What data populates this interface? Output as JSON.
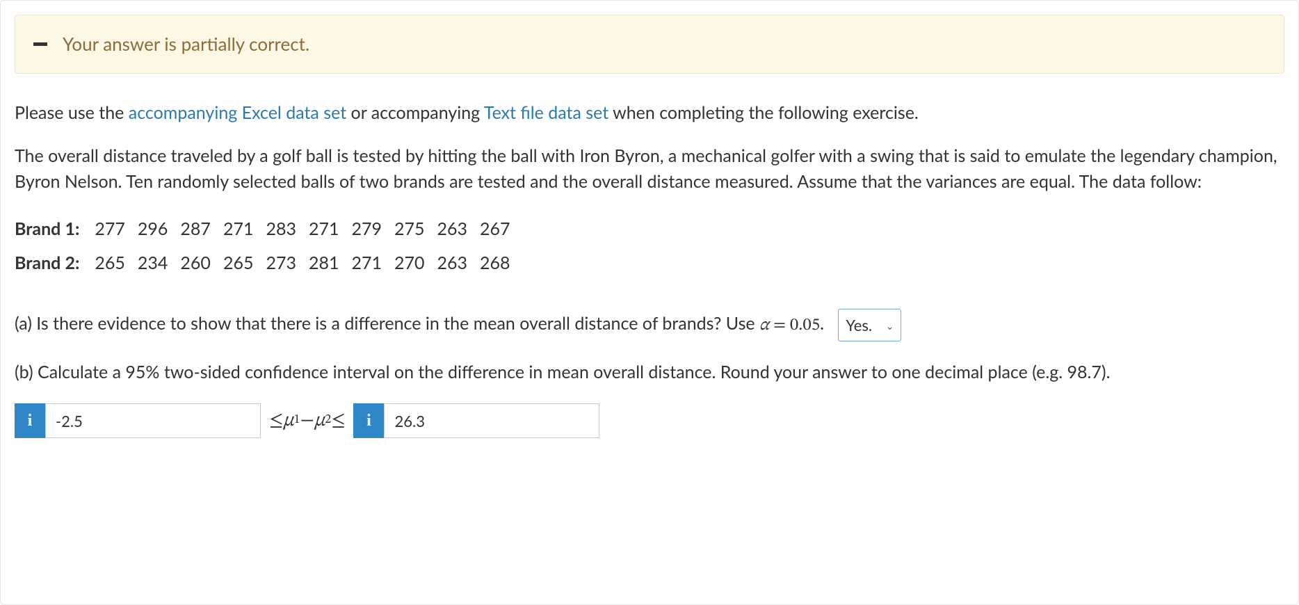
{
  "feedback": {
    "icon_name": "minus-icon",
    "message": "Your answer is partially correct."
  },
  "intro": {
    "prefix": "Please use the ",
    "excel_link": "accompanying Excel data set",
    "mid1": " or accompanying ",
    "text_link": "Text file data set",
    "suffix": " when completing the following exercise."
  },
  "description": "The overall distance traveled by a golf ball is tested by hitting the ball with Iron Byron, a mechanical golfer with a swing that is said to emulate the legendary champion, Byron Nelson. Ten randomly selected balls of two brands are tested and the overall distance measured. Assume that the variances are equal. The data follow:",
  "data_table": {
    "rows": [
      {
        "label": "Brand 1:",
        "values": [
          "277",
          "296",
          "287",
          "271",
          "283",
          "271",
          "279",
          "275",
          "263",
          "267"
        ]
      },
      {
        "label": "Brand 2:",
        "values": [
          "265",
          "234",
          "260",
          "265",
          "273",
          "281",
          "271",
          "270",
          "263",
          "268"
        ]
      }
    ]
  },
  "part_a": {
    "text_before": "(a) Is there evidence to show that there is a difference in the mean overall distance of brands? Use ",
    "alpha_symbol": "α",
    "equals": " = ",
    "alpha_value": "0.05",
    "period": ".",
    "select_value": "Yes."
  },
  "part_b": {
    "text": "(b) Calculate a 95% two-sided confidence interval on the difference in mean overall distance. Round your answer to one decimal place (e.g. 98.7).",
    "lower_value": "-2.5",
    "relation_text": "≤ μ1 − μ2 ≤",
    "upper_value": "26.3",
    "info_badge": "i"
  }
}
